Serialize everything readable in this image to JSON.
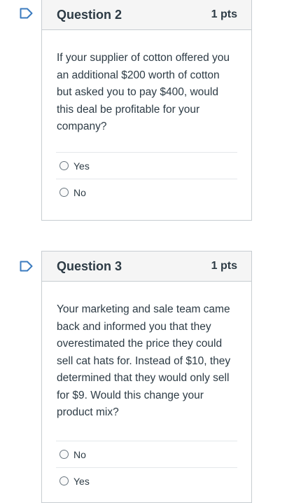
{
  "questions": [
    {
      "title": "Question 2",
      "points": "1 pts",
      "text": "If your supplier of cotton offered you an additional $200 worth of cotton but asked you to pay $400, would this deal be profitable for your company?",
      "answers": [
        "Yes",
        "No"
      ]
    },
    {
      "title": "Question 3",
      "points": "1 pts",
      "text": "Your marketing and sale team came back and informed you that they overestimated the price they could sell cat hats for. Instead of $10, they determined that they would only sell for $9. Would this change your product mix?",
      "answers": [
        "No",
        "Yes"
      ]
    }
  ],
  "icons": {
    "flag": "flag-question-icon"
  },
  "colors": {
    "flag_stroke": "#3b7bbf",
    "border": "#c7cdd1",
    "header_bg": "#f5f5f5"
  }
}
